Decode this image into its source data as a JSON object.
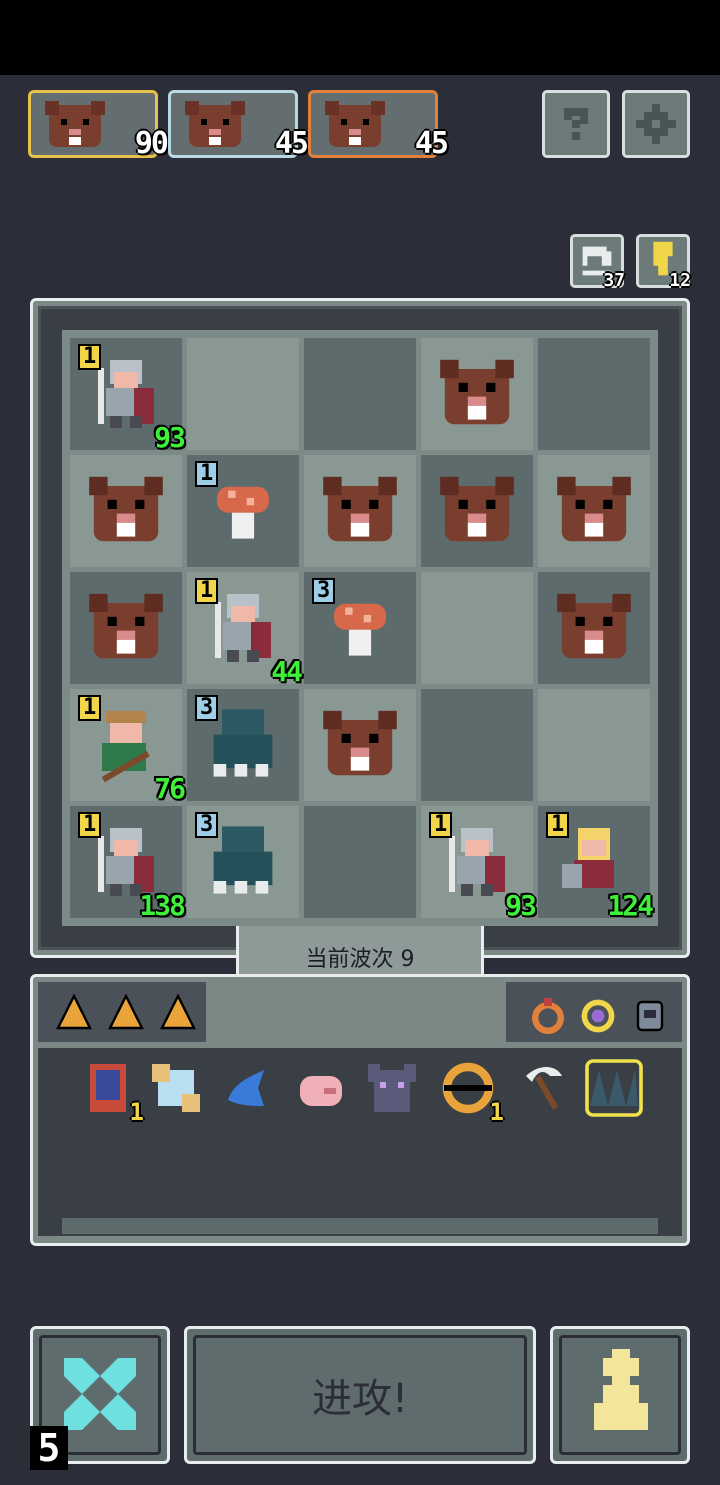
{
  "enemies": [
    {
      "hp": "90",
      "border": "#e7c24a"
    },
    {
      "hp": "45",
      "border": "#b8d8e2"
    },
    {
      "hp": "45",
      "border": "#e0803a"
    }
  ],
  "top_buttons": {
    "help_icon": "question-icon",
    "settings_icon": "gear-icon"
  },
  "counters": {
    "refresh": "37",
    "key": "12"
  },
  "wave_label": "当前波次 9",
  "board": {
    "rows": [
      [
        {
          "t": "soldier",
          "lvl": "1",
          "hp": "93"
        },
        {
          "t": "empty"
        },
        {
          "t": "empty"
        },
        {
          "t": "rat"
        },
        {
          "t": "empty"
        }
      ],
      [
        {
          "t": "rat"
        },
        {
          "t": "mushroom",
          "lvl": "1"
        },
        {
          "t": "rat"
        },
        {
          "t": "rat"
        },
        {
          "t": "rat"
        }
      ],
      [
        {
          "t": "rat"
        },
        {
          "t": "soldier",
          "lvl": "1",
          "hp": "44"
        },
        {
          "t": "mushroom",
          "lvl": "3"
        },
        {
          "t": "empty"
        },
        {
          "t": "rat"
        }
      ],
      [
        {
          "t": "archer",
          "lvl": "1",
          "hp": "76"
        },
        {
          "t": "cloak",
          "lvl": "3"
        },
        {
          "t": "rat"
        },
        {
          "t": "empty"
        },
        {
          "t": "empty"
        }
      ],
      [
        {
          "t": "soldier",
          "lvl": "1",
          "hp": "138"
        },
        {
          "t": "cloak",
          "lvl": "3"
        },
        {
          "t": "empty"
        },
        {
          "t": "soldier",
          "lvl": "1",
          "hp": "93"
        },
        {
          "t": "paladin",
          "lvl": "1",
          "hp": "124"
        }
      ]
    ]
  },
  "inventory": {
    "items": [
      {
        "name": "book",
        "qty": "1"
      },
      {
        "name": "scroll",
        "qty": ""
      },
      {
        "name": "blue-fish",
        "qty": ""
      },
      {
        "name": "pig",
        "qty": ""
      },
      {
        "name": "wolf",
        "qty": ""
      },
      {
        "name": "eye-ring",
        "qty": "1"
      },
      {
        "name": "scythe",
        "qty": ""
      },
      {
        "name": "spike-trap",
        "qty": ""
      }
    ]
  },
  "controls": {
    "attack_label": "进攻!",
    "turns_left": "5"
  },
  "colors": {
    "green_hp": "#3ef03a",
    "gold_badge": "#f1d64a",
    "blue_badge": "#9ecfe8"
  }
}
